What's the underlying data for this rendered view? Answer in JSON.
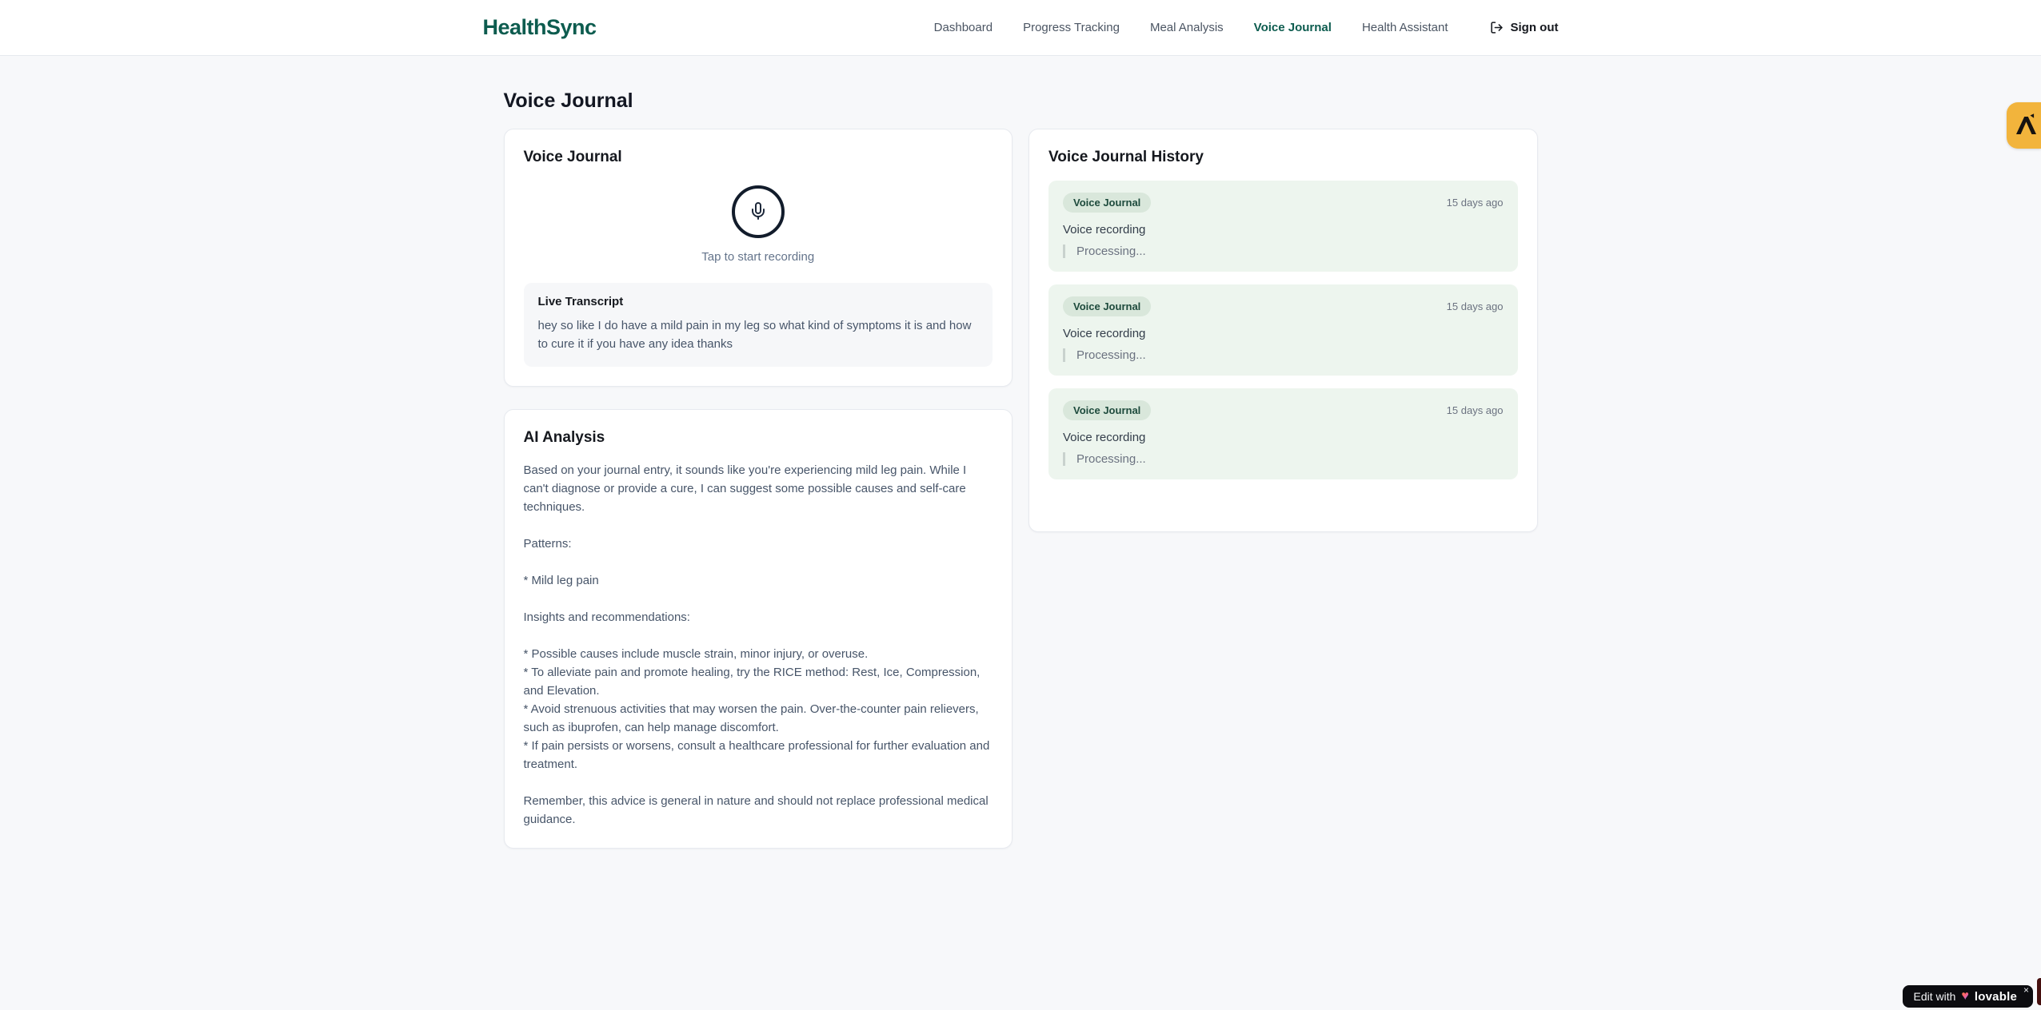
{
  "header": {
    "brand": "HealthSync",
    "nav": {
      "items": [
        {
          "label": "Dashboard",
          "active": false
        },
        {
          "label": "Progress Tracking",
          "active": false
        },
        {
          "label": "Meal Analysis",
          "active": false
        },
        {
          "label": "Voice Journal",
          "active": true
        },
        {
          "label": "Health Assistant",
          "active": false
        }
      ],
      "sign_out_label": "Sign out"
    }
  },
  "page": {
    "title": "Voice Journal"
  },
  "recorder_card": {
    "title": "Voice Journal",
    "mic_icon": "microphone-icon",
    "tap_hint": "Tap to start recording",
    "live_transcript": {
      "title": "Live Transcript",
      "text": "hey so like I do have a mild pain in my leg so what kind of symptoms it is and how to cure it if you have any idea thanks"
    }
  },
  "analysis_card": {
    "title": "AI Analysis",
    "body": "Based on your journal entry, it sounds like you're experiencing mild leg pain. While I can't diagnose or provide a cure, I can suggest some possible causes and self-care techniques.\n\nPatterns:\n\n* Mild leg pain\n\nInsights and recommendations:\n\n* Possible causes include muscle strain, minor injury, or overuse.\n* To alleviate pain and promote healing, try the RICE method: Rest, Ice, Compression, and Elevation.\n* Avoid strenuous activities that may worsen the pain. Over-the-counter pain relievers, such as ibuprofen, can help manage discomfort.\n* If pain persists or worsens, consult a healthcare professional for further evaluation and treatment.\n\nRemember, this advice is general in nature and should not replace professional medical guidance."
  },
  "history_card": {
    "title": "Voice Journal History",
    "entries": [
      {
        "badge": "Voice Journal",
        "time": "15 days ago",
        "title": "Voice recording",
        "status": "Processing..."
      },
      {
        "badge": "Voice Journal",
        "time": "15 days ago",
        "title": "Voice recording",
        "status": "Processing..."
      },
      {
        "badge": "Voice Journal",
        "time": "15 days ago",
        "title": "Voice recording",
        "status": "Processing..."
      }
    ]
  },
  "overlays": {
    "side_tab_icon": "amber-extension-icon",
    "edit_badge": {
      "prefix": "Edit with",
      "heart_glyph": "♥",
      "brand": "lovable",
      "close_glyph": "×"
    }
  },
  "colors": {
    "brand_teal": "#0d5c4f",
    "page_background": "#f7f8fa",
    "entry_green": "#edf5ee",
    "badge_green": "#d9e7db",
    "badge_text": "#1d4a3c",
    "side_tab_amber": "#f2b43c",
    "edit_badge_black": "#0c0c10"
  }
}
